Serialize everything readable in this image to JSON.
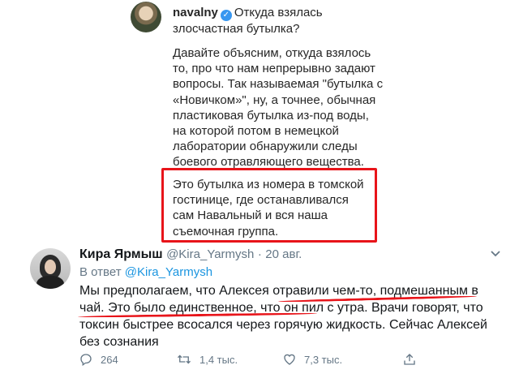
{
  "post": {
    "username": "navalny",
    "title_line1": "Откуда взялась",
    "title_line2": "злосчастная бутылка?",
    "body": "Давайте объясним, откуда взялось то, про что нам непрерывно задают вопросы. Так называемая \"бутылка с «Новичком»\", ну, а точнее, обычная пластиковая бутылка из-под воды, на которой потом в немецкой лаборатории обнаружили следы боевого отравляющего вещества.",
    "quote": "Это бутылка из номера в томской гостинице, где останавливался сам Навальный и вся наша съемочная группа.",
    "highlight_color": "#e8141a"
  },
  "tweet": {
    "name": "Кира Ярмыш",
    "handle": "@Kira_Yarmysh",
    "dot": "·",
    "date": "20 авг.",
    "reply_prefix": "В ответ",
    "reply_to": "@Kira_Yarmysh",
    "text": "Мы предполагаем, что Алексея отравили чем-то, подмешанным в чай. Это было единственное, что он пил с утра. Врачи говорят, что токсин быстрее всосался через горячую жидкость. Сейчас Алексей без сознания",
    "actions": {
      "reply_count": "264",
      "retweet_count": "1,4 тыс.",
      "like_count": "7,3 тыс."
    },
    "link_color": "#1b95e0",
    "muted_color": "#657786"
  }
}
